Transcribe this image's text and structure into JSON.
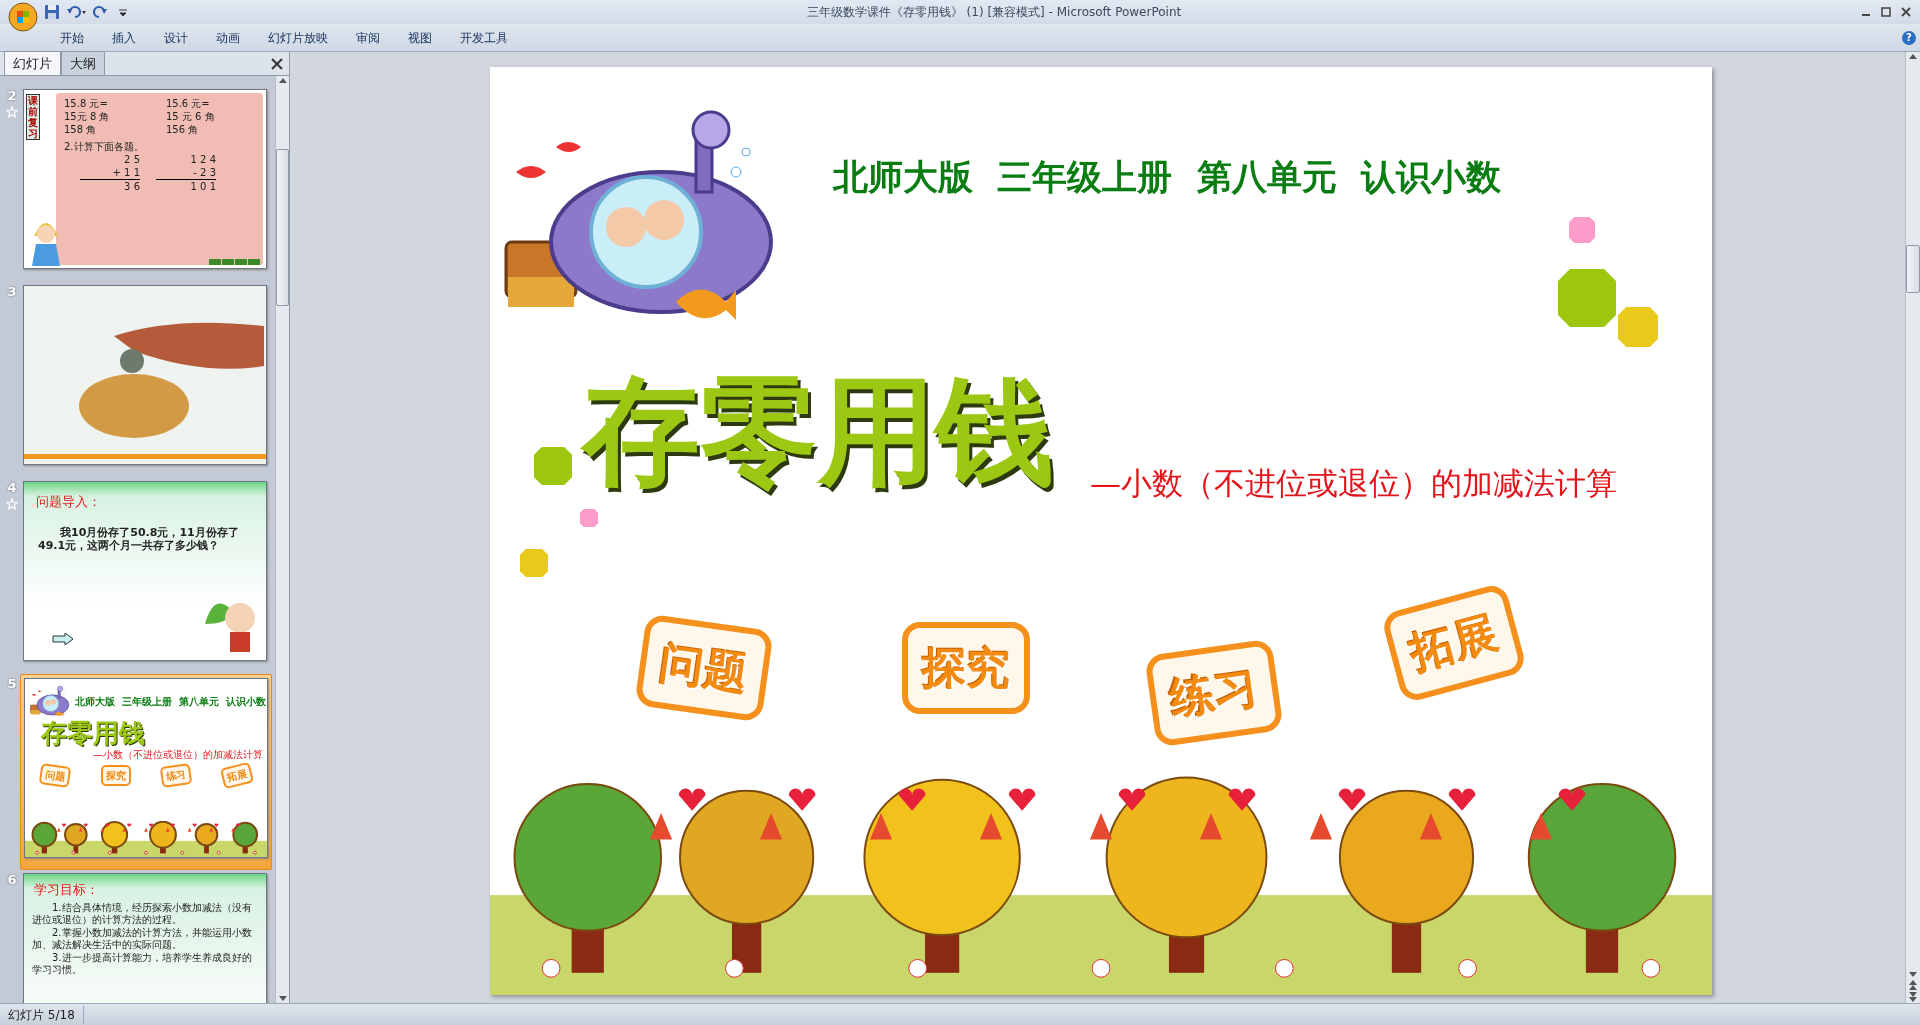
{
  "window": {
    "title": "三年级数学课件《存零用钱》 (1) [兼容模式] - Microsoft PowerPoint"
  },
  "ribbon": {
    "tabs": [
      "开始",
      "插入",
      "设计",
      "动画",
      "幻灯片放映",
      "审阅",
      "视图",
      "开发工具"
    ],
    "help": "?"
  },
  "panel_tabs": [
    {
      "label": "幻灯片",
      "selected": true
    },
    {
      "label": "大纲",
      "selected": false
    }
  ],
  "slides": [
    {
      "number": "2",
      "kind": "review",
      "animated": true,
      "selected": false,
      "banner": "课前复习",
      "conversions": [
        [
          "15.8 元=",
          "15元 8 角",
          "158 角"
        ],
        [
          "15.6 元=",
          "15 元 6 角",
          "156 角"
        ]
      ],
      "task": "2.计算下面各题。",
      "sums": [
        [
          "2 5",
          "+ 1 1",
          "3 6"
        ],
        [
          "1 2 4",
          "- 2 3",
          "1 0 1"
        ]
      ]
    },
    {
      "number": "3",
      "kind": "photo",
      "animated": false,
      "selected": false
    },
    {
      "number": "4",
      "kind": "problem",
      "animated": true,
      "selected": false,
      "heading": "问题导入：",
      "body": "我10月份存了50.8元，11月份存了49.1元，这两个月一共存了多少钱？"
    },
    {
      "number": "5",
      "kind": "title",
      "animated": false,
      "selected": true,
      "header": "北师大版  三年级上册  第八单元  认识小数",
      "title": "存零用钱",
      "subtitle": "—小数（不进位或退位）的加减法计算",
      "buttons": [
        "问题",
        "探究",
        "练习",
        "拓展"
      ]
    },
    {
      "number": "6",
      "kind": "goals",
      "animated": false,
      "selected": false,
      "heading": "学习目标：",
      "points": [
        "1.结合具体情境，经历探索小数加减法（没有进位或退位）的计算方法的过程。",
        "2.掌握小数加减法的计算方法，并能运用小数加、减法解决生活中的实际问题。",
        "3.进一步提高计算能力，培养学生养成良好的学习习惯。"
      ]
    }
  ],
  "slide": {
    "header": "北师大版  三年级上册  第八单元  认识小数",
    "title": "存零用钱",
    "subtitle": "—小数（不进位或退位）的加减法计算",
    "buttons": [
      "问题",
      "探究",
      "练习",
      "拓展"
    ]
  },
  "status_bar": {
    "slide_counter": "幻灯片 5/18"
  }
}
